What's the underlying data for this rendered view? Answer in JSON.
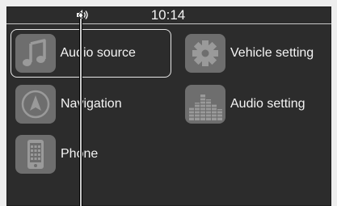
{
  "status_bar": {
    "time": "10:14",
    "volume_icon": "speaker-volume-icon"
  },
  "menu": {
    "items": [
      {
        "label": "Audio source",
        "icon": "music-note-icon",
        "selected": true
      },
      {
        "label": "Vehicle setting",
        "icon": "gear-icon",
        "selected": false
      },
      {
        "label": "Navigation",
        "icon": "navigation-arrow-icon",
        "selected": false
      },
      {
        "label": "Audio setting",
        "icon": "equalizer-icon",
        "selected": false
      },
      {
        "label": "Phone",
        "icon": "phone-icon",
        "selected": false
      }
    ]
  },
  "colors": {
    "display_bg": "#2c2c2c",
    "tile_icon_bg": "#6e6e6e",
    "text": "#f4f4f4",
    "selection_border": "#e6e6e6",
    "page_bg": "#eeeeee"
  }
}
